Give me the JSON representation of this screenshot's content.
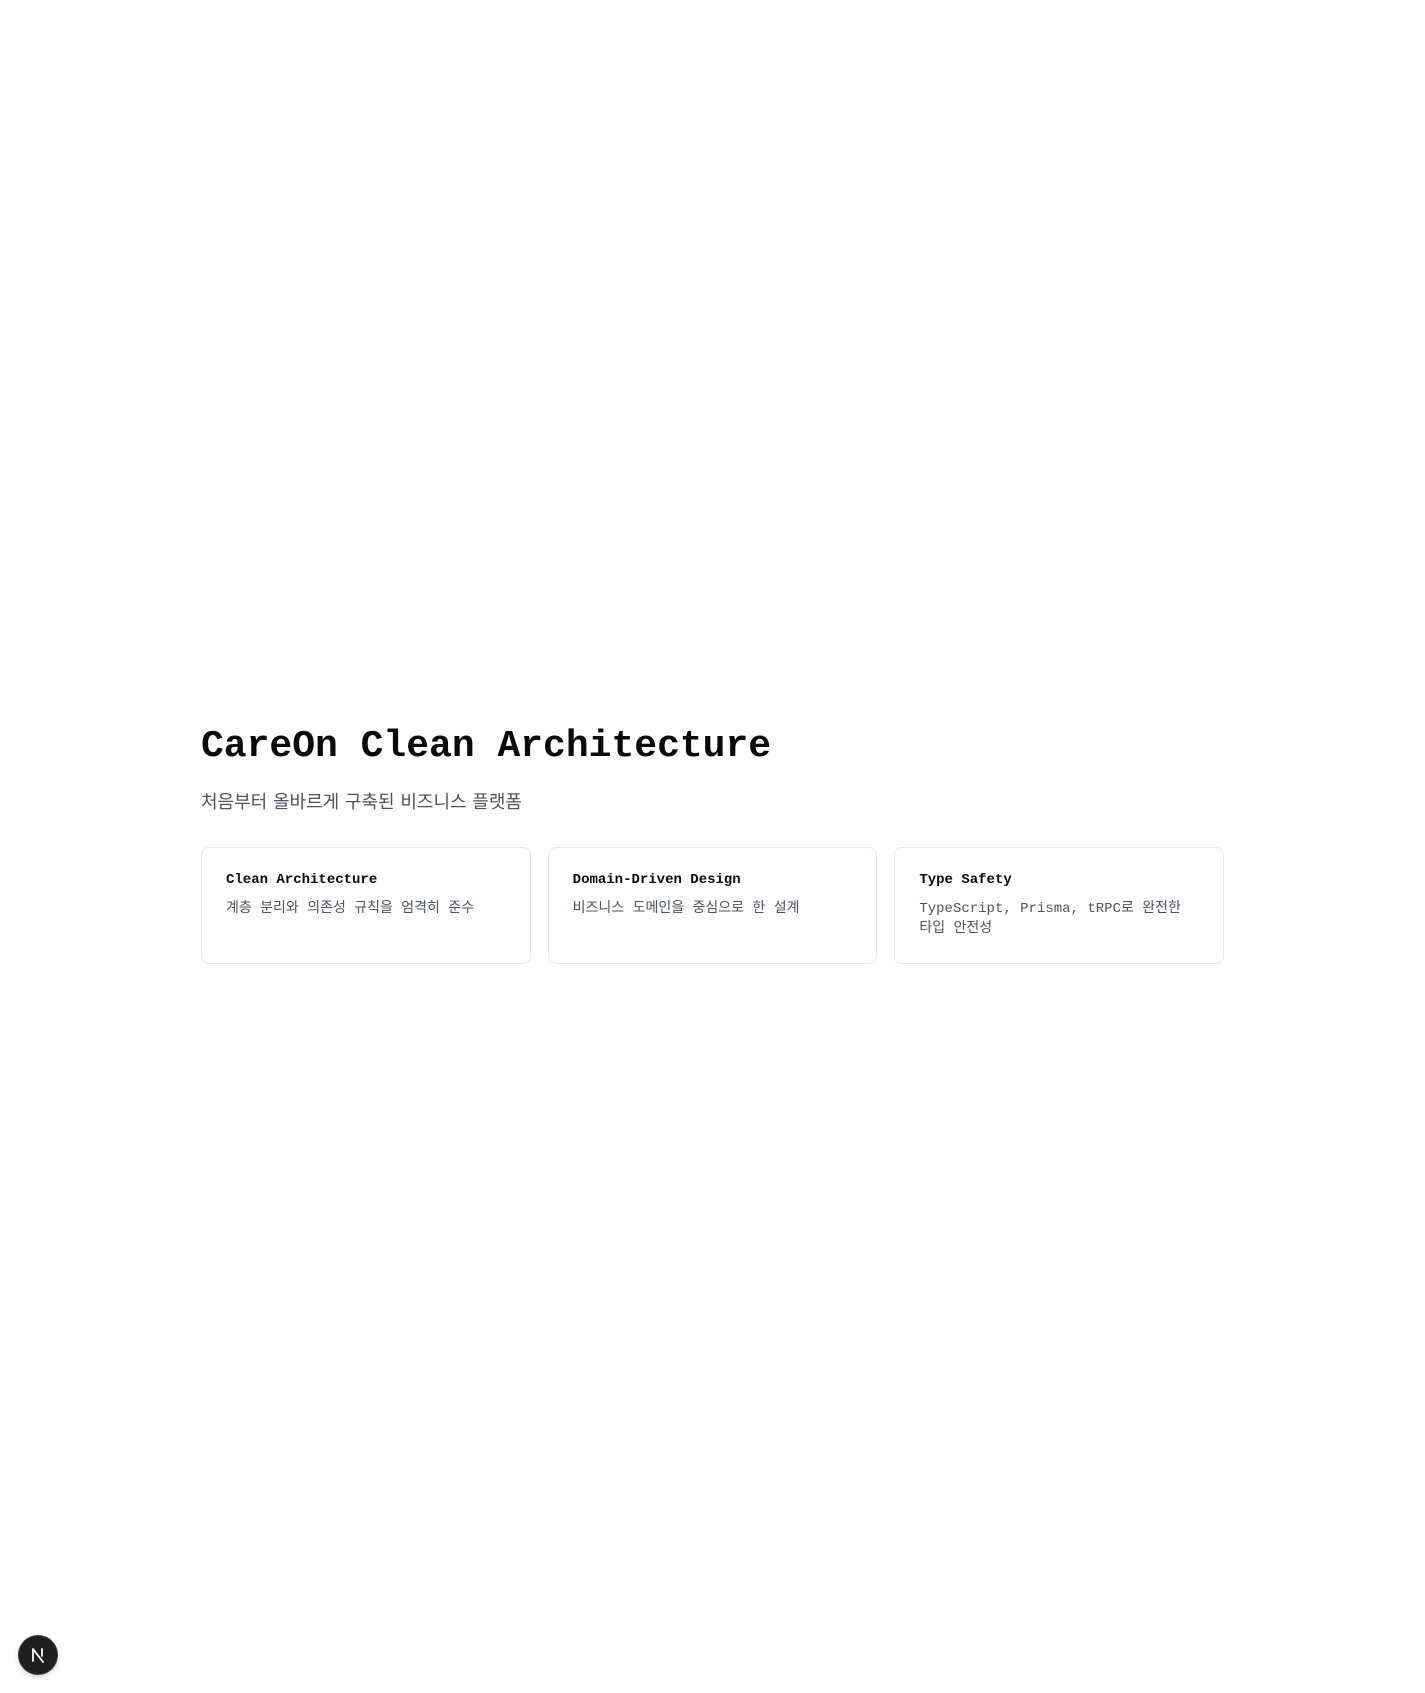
{
  "hero": {
    "title": "CareOn Clean Architecture",
    "subtitle": "처음부터 올바르게 구축된 비즈니스 플랫폼"
  },
  "features": [
    {
      "title": "Clean Architecture",
      "description": "계층 분리와 의존성 규칙을 엄격히 준수"
    },
    {
      "title": "Domain-Driven Design",
      "description": "비즈니스 도메인을 중심으로 한 설계"
    },
    {
      "title": "Type Safety",
      "description": "TypeScript, Prisma, tRPC로 완전한 타입 안전성"
    }
  ],
  "dev_indicator": {
    "icon": "nextjs-logo-icon",
    "colors": {
      "background": "#1f1f1f",
      "glyph": "#ffffff"
    }
  }
}
